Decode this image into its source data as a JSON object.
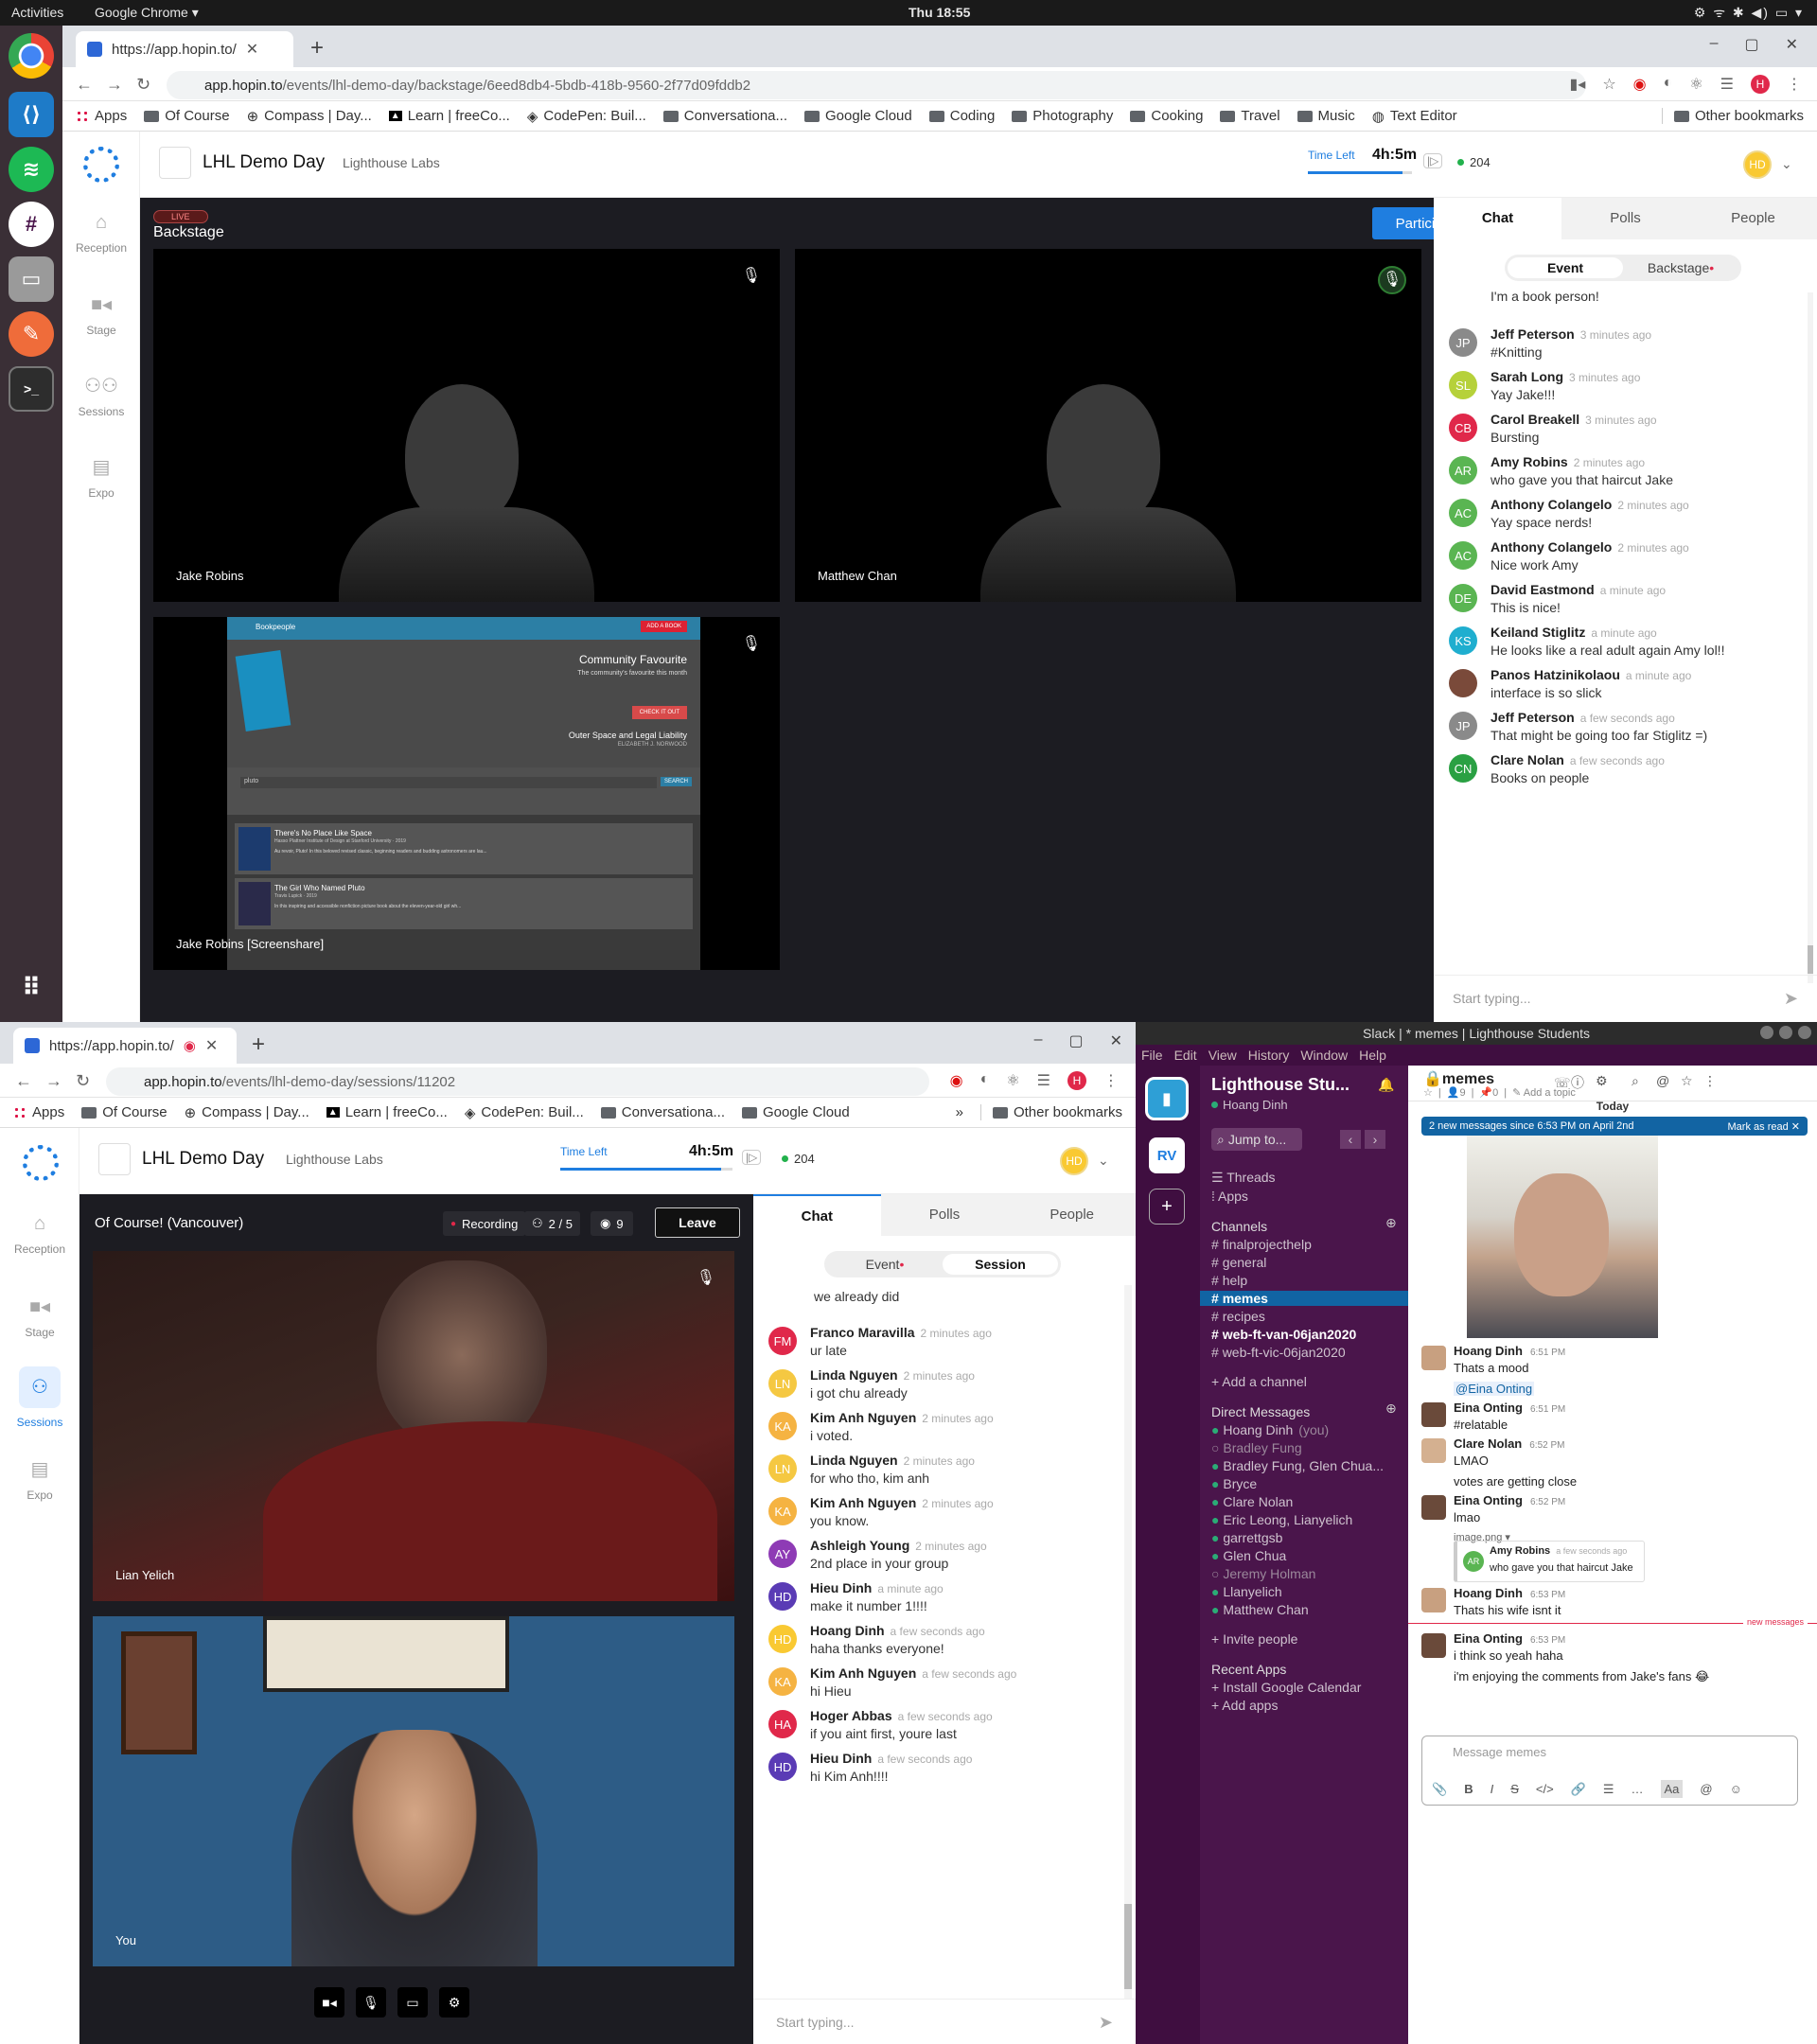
{
  "topbar": {
    "activities": "Activities",
    "app": "Google Chrome ▾",
    "clock": "Thu 18:55",
    "tray": "⚙ ᯤ ✱ ◀) ▭ ▾"
  },
  "browser1": {
    "tab_title": "https://app.hopin.to/",
    "url_domain": "app.hopin.to",
    "url_path": "/events/lhl-demo-day/backstage/6eed8db4-5bdb-418b-9560-2f77d09fddb2",
    "bookmarks": [
      "Apps",
      "Of Course",
      "Compass | Day...",
      "Learn | freeCo...",
      "CodePen: Buil...",
      "Conversationa...",
      "Google Cloud",
      "Coding",
      "Photography",
      "Cooking",
      "Travel",
      "Music",
      "Text Editor"
    ],
    "other_bookmarks": "Other bookmarks"
  },
  "browser2": {
    "tab_title": "https://app.hopin.to/",
    "url_domain": "app.hopin.to",
    "url_path": "/events/lhl-demo-day/sessions/11202",
    "bookmarks": [
      "Apps",
      "Of Course",
      "Compass | Day...",
      "Learn | freeCo...",
      "CodePen: Buil...",
      "Conversationa...",
      "Google Cloud"
    ],
    "more": "»",
    "other_bookmarks": "Other bookmarks"
  },
  "hopin": {
    "event_title": "LHL Demo Day",
    "org": "Lighthouse Labs",
    "time_left_label": "Time Left",
    "time_left": "4h:5m",
    "online": "204",
    "avatar": "HD",
    "nav": [
      "Reception",
      "Stage",
      "Sessions",
      "Expo"
    ]
  },
  "backstage": {
    "live_badge": "LIVE",
    "title": "Backstage",
    "participate": "Participate",
    "tiles": [
      "Jake Robins",
      "Matthew Chan",
      "Jake Robins [Screenshare]"
    ],
    "screenshare": {
      "app": "Bookpeople",
      "add": "ADD A BOOK",
      "fav_title": "Community Favourite",
      "fav_sub": "The community's favourite this month",
      "check": "CHECK IT OUT",
      "book": "Outer Space and Legal Liability",
      "author": "ELIZABETH J. NORWOOD",
      "search_val": "pluto",
      "search_btn": "SEARCH",
      "r1_title": "There's No Place Like Space",
      "r1_sub": "Hasso Plattner Institute of Design at Stanford University · 2019",
      "r1_desc": "Au revoir, Pluto! In this beloved revised classic, beginning readers and budding astronomers are lau...",
      "r2_title": "The Girl Who Named Pluto",
      "r2_sub": "Travis Lupick · 2019",
      "r2_desc": "In this inspiring and accessible nonfiction picture book about the eleven-year-old girl wh..."
    }
  },
  "panel1": {
    "tabs": [
      "Chat",
      "Polls",
      "People"
    ],
    "seg": [
      "Event",
      "Backstage"
    ],
    "partial": "I'm a book person!",
    "messages": [
      {
        "i": "JP",
        "c": "#8a8a8a",
        "n": "Jeff Peterson",
        "t": "3 minutes ago",
        "m": "#Knitting"
      },
      {
        "i": "SL",
        "c": "#b6d13a",
        "n": "Sarah Long",
        "t": "3 minutes ago",
        "m": "Yay Jake!!!"
      },
      {
        "i": "CB",
        "c": "#e0284a",
        "n": "Carol Breakell",
        "t": "3 minutes ago",
        "m": "Bursting"
      },
      {
        "i": "AR",
        "c": "#5ab552",
        "n": "Amy Robins",
        "t": "2 minutes ago",
        "m": "who gave you that haircut Jake"
      },
      {
        "i": "AC",
        "c": "#5ab552",
        "n": "Anthony Colangelo",
        "t": "2 minutes ago",
        "m": "Yay space nerds!"
      },
      {
        "i": "AC",
        "c": "#5ab552",
        "n": "Anthony Colangelo",
        "t": "2 minutes ago",
        "m": "Nice work Amy"
      },
      {
        "i": "DE",
        "c": "#5ab552",
        "n": "David Eastmond",
        "t": "a minute ago",
        "m": "This is nice!"
      },
      {
        "i": "KS",
        "c": "#1faecf",
        "n": "Keiland Stiglitz",
        "t": "a minute ago",
        "m": "He looks like a real adult again Amy lol!!"
      },
      {
        "i": "",
        "c": "#7a4a3a",
        "n": "Panos Hatzinikolaou",
        "t": "a minute ago",
        "m": "interface is so slick"
      },
      {
        "i": "JP",
        "c": "#8a8a8a",
        "n": "Jeff Peterson",
        "t": "a few seconds ago",
        "m": "That might be going too far Stiglitz =)"
      },
      {
        "i": "CN",
        "c": "#2aa043",
        "n": "Clare Nolan",
        "t": "a few seconds ago",
        "m": "Books on people"
      }
    ],
    "placeholder": "Start typing..."
  },
  "session": {
    "title": "Of Course! (Vancouver)",
    "recording": "Recording",
    "participants": "2 / 5",
    "viewers": "9",
    "leave": "Leave",
    "tiles": [
      "Lian Yelich",
      "You"
    ]
  },
  "panel2": {
    "tabs": [
      "Chat",
      "Polls",
      "People"
    ],
    "seg": [
      "Event",
      "Session"
    ],
    "partial": "we already did",
    "messages": [
      {
        "i": "FM",
        "c": "#e0284a",
        "n": "Franco Maravilla",
        "t": "2 minutes ago",
        "m": "ur late"
      },
      {
        "i": "LN",
        "c": "#f5c842",
        "n": "Linda Nguyen",
        "t": "2 minutes ago",
        "m": "i got chu already"
      },
      {
        "i": "KA",
        "c": "#f5b342",
        "n": "Kim Anh Nguyen",
        "t": "2 minutes ago",
        "m": "i voted."
      },
      {
        "i": "LN",
        "c": "#f5c842",
        "n": "Linda Nguyen",
        "t": "2 minutes ago",
        "m": "for who tho, kim anh"
      },
      {
        "i": "KA",
        "c": "#f5b342",
        "n": "Kim Anh Nguyen",
        "t": "2 minutes ago",
        "m": "you know."
      },
      {
        "i": "AY",
        "c": "#8e3bb5",
        "n": "Ashleigh Young",
        "t": "2 minutes ago",
        "m": "2nd place in your group"
      },
      {
        "i": "HD",
        "c": "#5a3bb5",
        "n": "Hieu Dinh",
        "t": "a minute ago",
        "m": "make it number 1!!!!"
      },
      {
        "i": "HD",
        "c": "#f9c932",
        "n": "Hoang Dinh",
        "t": "a few seconds ago",
        "m": "haha thanks everyone!"
      },
      {
        "i": "KA",
        "c": "#f5b342",
        "n": "Kim Anh Nguyen",
        "t": "a few seconds ago",
        "m": "hi Hieu"
      },
      {
        "i": "HA",
        "c": "#e0284a",
        "n": "Hoger Abbas",
        "t": "a few seconds ago",
        "m": "if you aint first, youre last"
      },
      {
        "i": "HD",
        "c": "#5a3bb5",
        "n": "Hieu Dinh",
        "t": "a few seconds ago",
        "m": "hi Kim Anh!!!!"
      }
    ],
    "placeholder": "Start typing..."
  },
  "slack": {
    "title": "Slack | * memes | Lighthouse Students",
    "menu": [
      "File",
      "Edit",
      "View",
      "History",
      "Window",
      "Help"
    ],
    "workspace": "Lighthouse Stu...",
    "user": "Hoang Dinh",
    "jump": "Jump to...",
    "threads": "Threads",
    "apps": "Apps",
    "channels_label": "Channels",
    "channels": [
      "finalprojecthelp",
      "general",
      "help",
      "memes",
      "recipes",
      "web-ft-van-06jan2020",
      "web-ft-vic-06jan2020"
    ],
    "add_channel": "Add a channel",
    "dm_label": "Direct Messages",
    "dms": [
      "Hoang Dinh",
      "Bradley Fung",
      "Bradley Fung, Glen Chua...",
      "Bryce",
      "Clare Nolan",
      "Eric Leong, Lianyelich",
      "garrettgsb",
      "Glen Chua",
      "Jeremy Holman",
      "Llanyelich",
      "Matthew Chan"
    ],
    "you": "(you)",
    "invite": "Invite people",
    "recent_apps": "Recent Apps",
    "install_gcal": "Install Google Calendar",
    "add_apps": "Add apps",
    "channel": "memes",
    "members": "9",
    "pins": "0",
    "topic": "Add a topic",
    "today": "Today",
    "banner": "2 new messages since 6:53 PM on April 2nd",
    "mark_read": "Mark as read",
    "new_messages": "new messages",
    "msgs": [
      {
        "n": "Hoang Dinh",
        "t": "6:51 PM",
        "lines": [
          "Thats a mood",
          "@Eina Onting"
        ]
      },
      {
        "n": "Eina Onting",
        "t": "6:51 PM",
        "lines": [
          "#relatable"
        ]
      },
      {
        "n": "Clare Nolan",
        "t": "6:52 PM",
        "lines": [
          "LMAO",
          "votes are getting close"
        ]
      },
      {
        "n": "Eina Onting",
        "t": "6:52 PM",
        "lines": [
          "lmao",
          "image.png ▾"
        ]
      },
      {
        "n": "Hoang Dinh",
        "t": "6:53 PM",
        "lines": [
          "Thats his wife isnt it"
        ]
      },
      {
        "n": "Eina Onting",
        "t": "6:53 PM",
        "lines": [
          "i think so yeah haha",
          "i'm enjoying the comments from Jake's fans 😂"
        ]
      }
    ],
    "quote": {
      "i": "AR",
      "n": "Amy Robins",
      "t": "a few seconds ago",
      "m": "who gave you that haircut Jake"
    },
    "composer": "Message memes"
  }
}
